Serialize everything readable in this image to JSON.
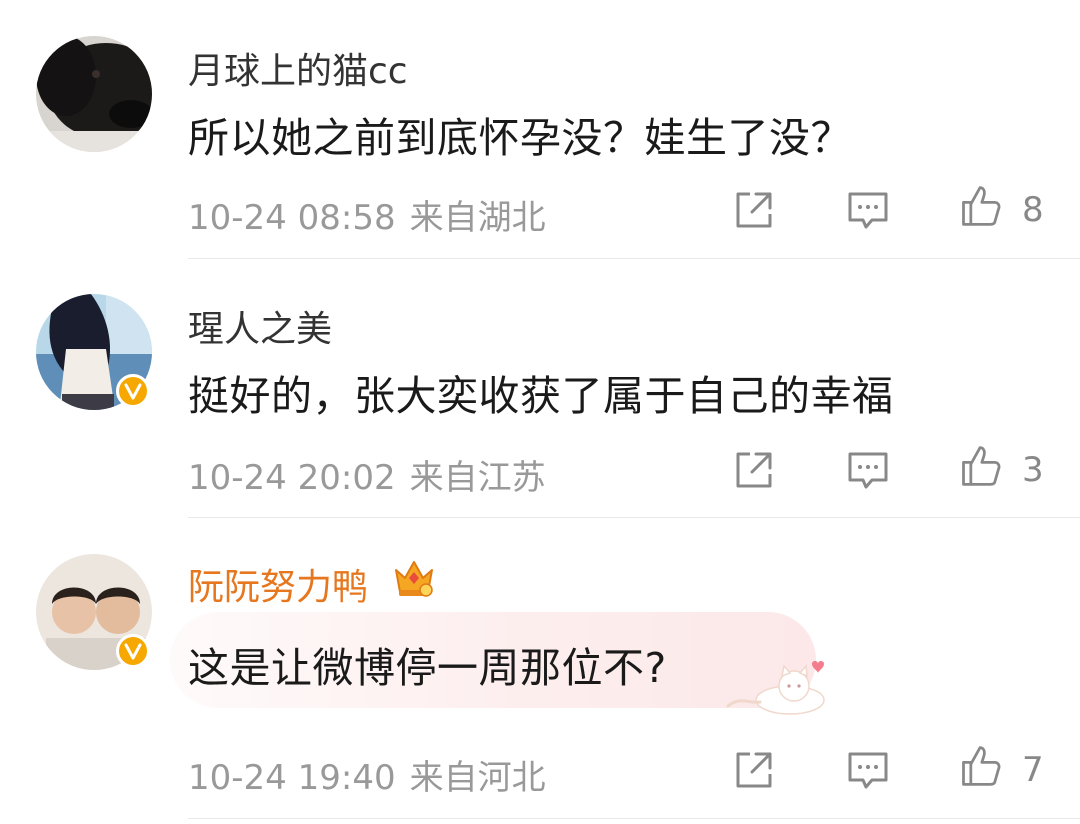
{
  "comments": [
    {
      "username": "月球上的猫cc",
      "verified": false,
      "vip_crown": false,
      "text": "所以她之前到底怀孕没？娃生了没？",
      "date": "10-24 08:58",
      "location": "来自湖北",
      "likes": "8"
    },
    {
      "username": "瑆人之美",
      "verified": true,
      "vip_crown": false,
      "text": "挺好的，张大奕收获了属于自己的幸福",
      "date": "10-24 20:02",
      "location": "来自江苏",
      "likes": "3"
    },
    {
      "username": "阮阮努力鸭",
      "verified": true,
      "vip_crown": true,
      "text": "这是让微博停一周那位不?",
      "date": "10-24 19:40",
      "location": "来自河北",
      "likes": "7"
    }
  ],
  "icons": {
    "share": "share-icon",
    "comment": "comment-icon",
    "like": "thumbs-up-icon",
    "verified": "verified-badge-icon",
    "crown": "crown-icon"
  },
  "colors": {
    "vip_name": "#e6771f",
    "verified_badge": "#f6a800",
    "meta": "#999999"
  }
}
